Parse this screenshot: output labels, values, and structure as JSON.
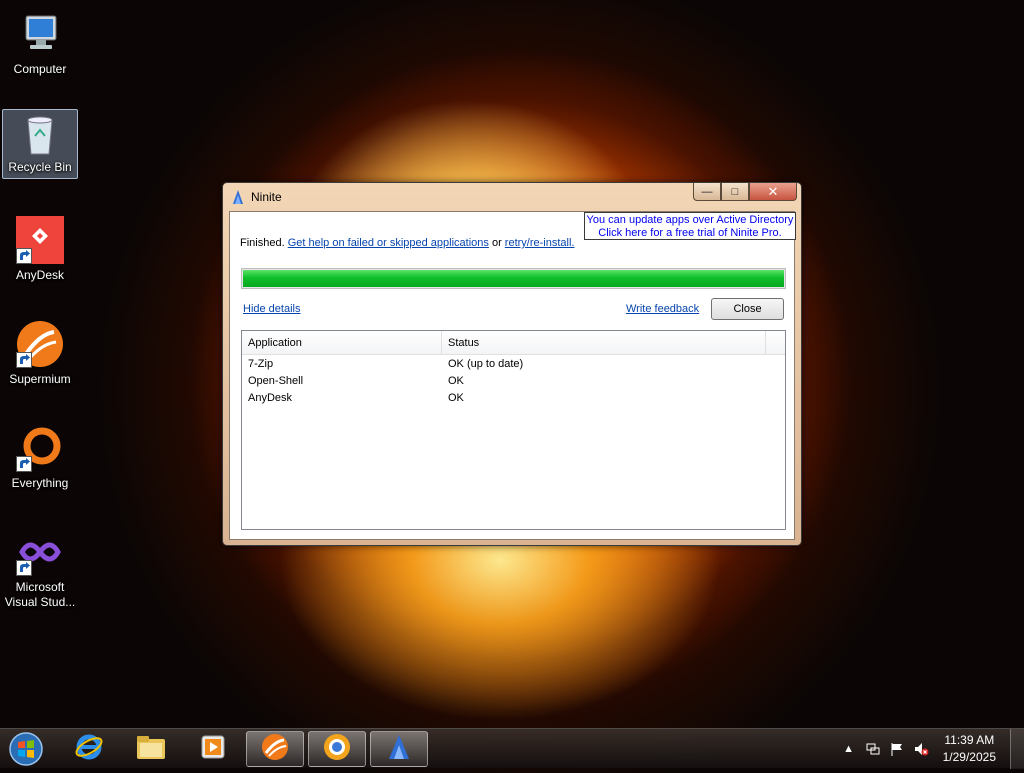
{
  "desktop": {
    "icons": [
      {
        "label": "Computer"
      },
      {
        "label": "Recycle Bin"
      },
      {
        "label": "AnyDesk"
      },
      {
        "label": "Supermium"
      },
      {
        "label": "Everything"
      },
      {
        "label": "Microsoft Visual Stud..."
      }
    ]
  },
  "window": {
    "title": "Ninite",
    "promo_line1": "You can update apps over Active Directory",
    "promo_line2": "Click here for a free trial of Ninite Pro.",
    "status_prefix": "Finished.",
    "help_link": "Get help on failed or skipped applications",
    "or_text": "or",
    "retry_link": "retry/re-install.",
    "progress": 1.0,
    "hide_details": "Hide details",
    "write_feedback": "Write feedback",
    "close_label": "Close",
    "table": {
      "columns": [
        "Application",
        "Status"
      ],
      "rows": [
        {
          "app": "7-Zip",
          "status": "OK (up to date)"
        },
        {
          "app": "Open-Shell",
          "status": "OK"
        },
        {
          "app": "AnyDesk",
          "status": "OK"
        }
      ]
    }
  },
  "taskbar": {
    "pinned": [
      "start-orb",
      "internet-explorer",
      "file-explorer",
      "media-player",
      "supermium",
      "supermium-alt",
      "ninite"
    ],
    "clock_time": "11:39 AM",
    "clock_date": "1/29/2025"
  },
  "colors": {
    "link": "#0645ad",
    "progress": "#0fbf2a",
    "promo_text": "#0000ee"
  }
}
